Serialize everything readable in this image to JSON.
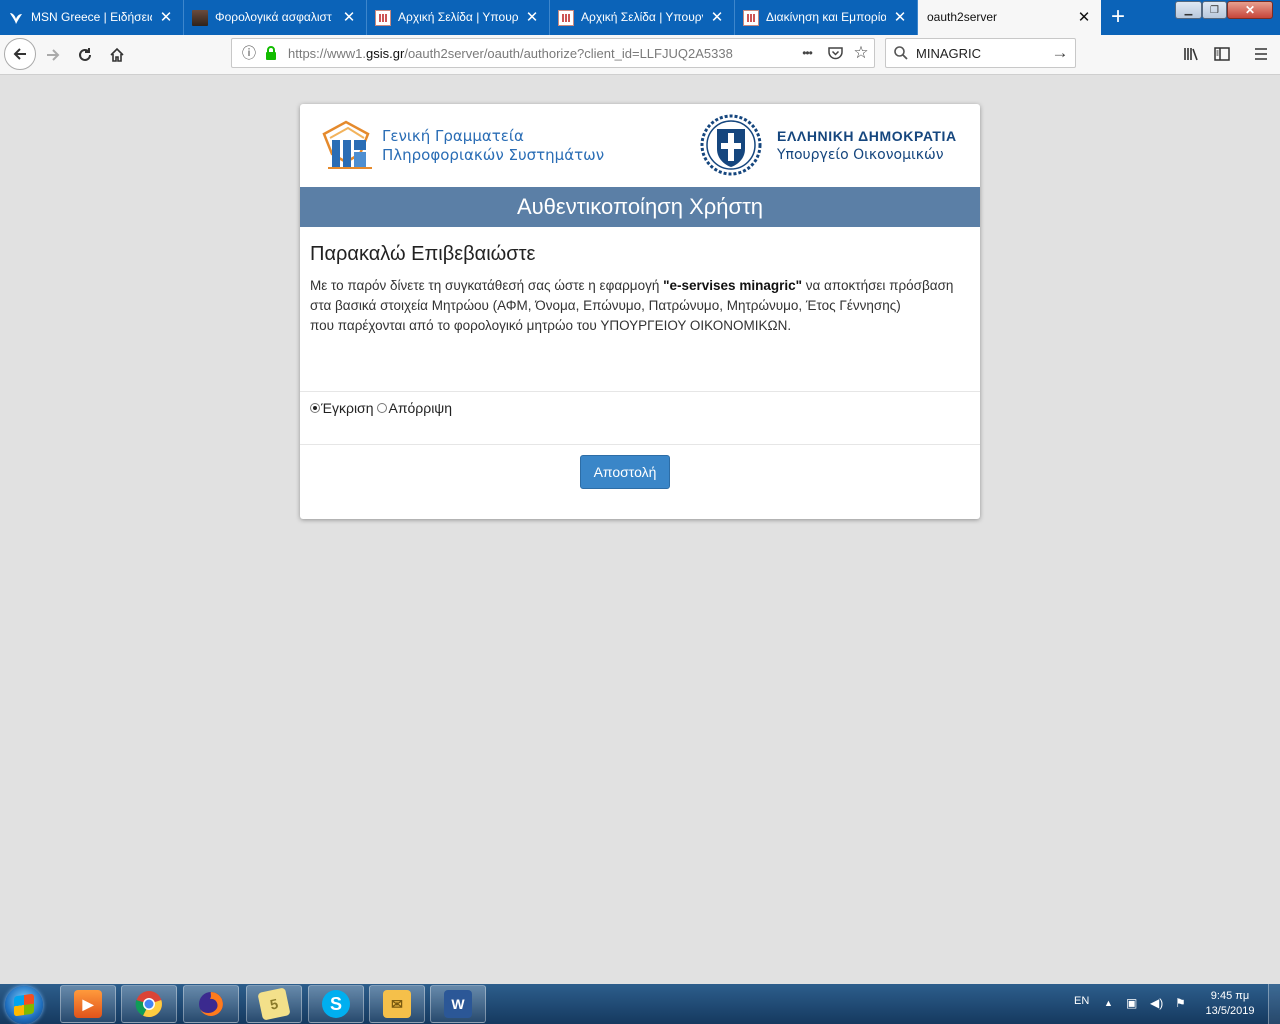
{
  "browser": {
    "tabs": [
      {
        "title": "MSN Greece | Ειδήσεις",
        "favicon": "msn-butterfly-icon",
        "active": false
      },
      {
        "title": "Φορολογικά ασφαλιστ",
        "favicon": "photo-favicon-icon",
        "active": false
      },
      {
        "title": "Αρχική Σελίδα | Υπουργ",
        "favicon": "gsis-favicon-icon",
        "active": false
      },
      {
        "title": "Αρχική Σελίδα | Υπουργ",
        "favicon": "gsis-favicon-icon",
        "active": false
      },
      {
        "title": "Διακίνηση και Εμπορία",
        "favicon": "gsis-favicon-icon",
        "active": false
      },
      {
        "title": "oauth2server",
        "favicon": "",
        "active": true
      }
    ],
    "new_tab_label": "+",
    "url_prefix": "https://www1.",
    "url_domain": "gsis.gr",
    "url_rest": "/oauth2server/oauth/authorize?client_id=LLFJUQ2A5338",
    "page_actions_label": "•••",
    "search_value": "MINAGRIC"
  },
  "page": {
    "gsis_line1": "Γενική Γραμματεία",
    "gsis_line2": "Πληροφοριακών Συστημάτων",
    "gov_title": "ΕΛΛΗΝΙΚΗ ΔΗΜΟΚΡΑΤΙΑ",
    "gov_subtitle": "Υπουργείο Οικονομικών",
    "auth_title": "Αυθεντικοποίηση Χρήστη",
    "confirm_title": "Παρακαλώ Επιβεβαιώστε",
    "consent_intro": "Με το παρόν δίνετε τη συγκατάθεσή σας ώστε η εφαρμογή ",
    "app_name": "\"e-servises minagric\"",
    "consent_rest": " να αποκτήσει πρόσβαση στα βασικά στοιχεία Μητρώου (ΑΦΜ, Όνομα, Επώνυμο, Πατρώνυμο, Μητρώνυμο, Έτος Γέννησης)",
    "consent_line2": "που παρέχονται από το φορολογικό μητρώο του ΥΠΟΥΡΓΕΙΟΥ ΟΙΚΟΝΟΜΙΚΩΝ.",
    "radio_approve": "Έγκριση",
    "radio_reject": "Απόρριψη",
    "selected_option": "approve",
    "submit_label": "Αποστολή",
    "colors": {
      "header_bar": "#5b7fa6",
      "button": "#3a86c8",
      "brand_blue": "#15467e"
    }
  },
  "taskbar": {
    "apps": [
      "media-player-icon",
      "chrome-icon",
      "firefox-icon",
      "sticky-notes-icon",
      "skype-icon",
      "outlook-icon",
      "word-icon"
    ],
    "language": "EN",
    "time": "9:45 πμ",
    "date": "13/5/2019"
  }
}
